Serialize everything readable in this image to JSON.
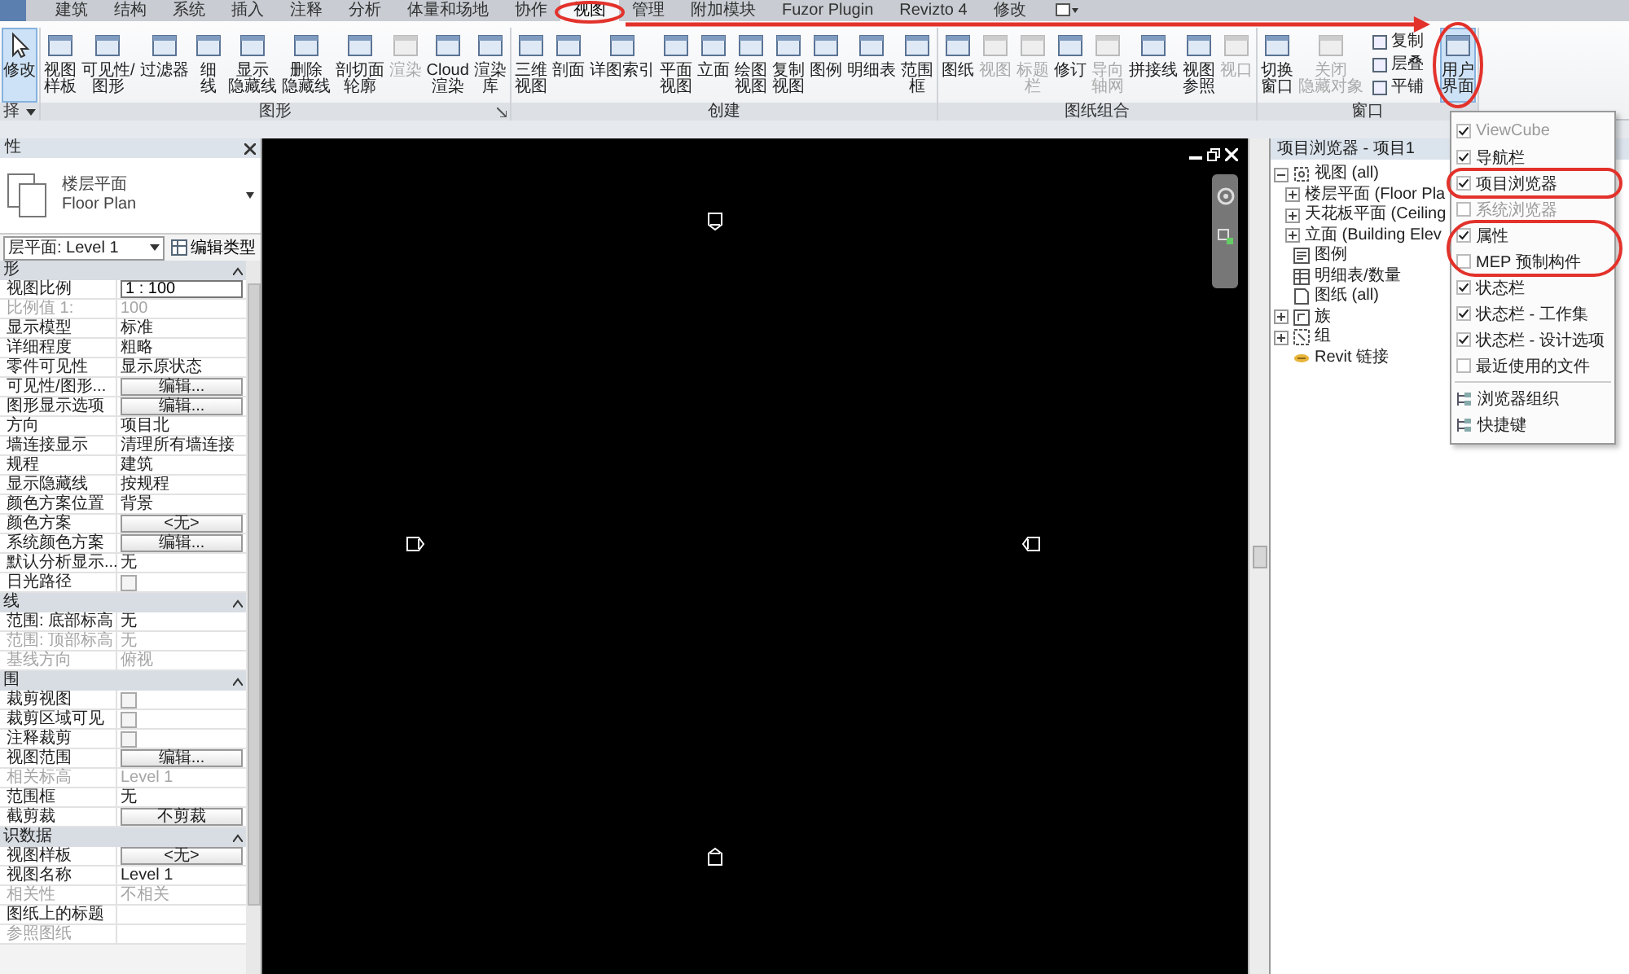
{
  "ribbon_tabs": [
    {
      "label": "建筑",
      "selected": false
    },
    {
      "label": "结构",
      "selected": false
    },
    {
      "label": "系统",
      "selected": false
    },
    {
      "label": "插入",
      "selected": false
    },
    {
      "label": "注释",
      "selected": false
    },
    {
      "label": "分析",
      "selected": false
    },
    {
      "label": "体量和场地",
      "selected": false
    },
    {
      "label": "协作",
      "selected": false
    },
    {
      "label": "视图",
      "selected": true
    },
    {
      "label": "管理",
      "selected": false
    },
    {
      "label": "附加模块",
      "selected": false
    },
    {
      "label": "Fuzor Plugin",
      "selected": false
    },
    {
      "label": "Revizto 4",
      "selected": false
    },
    {
      "label": "修改",
      "selected": false
    }
  ],
  "ribbon_groups": [
    {
      "label": "择",
      "dropdown": true,
      "buttons": [
        {
          "kind": "large",
          "lines": [
            "修改"
          ],
          "active": true,
          "disabled": false
        }
      ]
    },
    {
      "label": "图形",
      "launcher": true,
      "buttons": [
        {
          "kind": "large",
          "lines": [
            "视图",
            "样板"
          ],
          "active": false,
          "disabled": false
        },
        {
          "kind": "large",
          "lines": [
            "可见性/",
            "图形"
          ],
          "active": false,
          "disabled": false
        },
        {
          "kind": "large",
          "lines": [
            "过滤器"
          ],
          "active": false,
          "disabled": false
        },
        {
          "kind": "large",
          "lines": [
            "细",
            "线"
          ],
          "active": false,
          "disabled": false
        },
        {
          "kind": "large",
          "lines": [
            "显示",
            "隐藏线"
          ],
          "active": false,
          "disabled": false
        },
        {
          "kind": "large",
          "lines": [
            "删除",
            "隐藏线"
          ],
          "active": false,
          "disabled": false
        },
        {
          "kind": "large",
          "lines": [
            "剖切面",
            "轮廓"
          ],
          "active": false,
          "disabled": false
        },
        {
          "kind": "large",
          "lines": [
            "渲染"
          ],
          "active": false,
          "disabled": true
        },
        {
          "kind": "large",
          "lines": [
            "Cloud",
            "渲染"
          ],
          "active": false,
          "disabled": false
        },
        {
          "kind": "large",
          "lines": [
            "渲染",
            "库"
          ],
          "active": false,
          "disabled": false
        }
      ]
    },
    {
      "label": "创建",
      "buttons": [
        {
          "kind": "large",
          "lines": [
            "三维",
            "视图"
          ],
          "active": false,
          "disabled": false
        },
        {
          "kind": "large",
          "lines": [
            "剖面"
          ],
          "active": false,
          "disabled": false
        },
        {
          "kind": "large",
          "lines": [
            "详图索引"
          ],
          "active": false,
          "disabled": false
        },
        {
          "kind": "large",
          "lines": [
            "平面",
            "视图"
          ],
          "active": false,
          "disabled": false
        },
        {
          "kind": "large",
          "lines": [
            "立面"
          ],
          "active": false,
          "disabled": false
        },
        {
          "kind": "large",
          "lines": [
            "绘图",
            "视图"
          ],
          "active": false,
          "disabled": false
        },
        {
          "kind": "large",
          "lines": [
            "复制",
            "视图"
          ],
          "active": false,
          "disabled": false
        },
        {
          "kind": "large",
          "lines": [
            "图例"
          ],
          "active": false,
          "disabled": false
        },
        {
          "kind": "large",
          "lines": [
            "明细表"
          ],
          "active": false,
          "disabled": false
        },
        {
          "kind": "large",
          "lines": [
            "范围",
            "框"
          ],
          "active": false,
          "disabled": false
        }
      ]
    },
    {
      "label": "图纸组合",
      "buttons": [
        {
          "kind": "large",
          "lines": [
            "图纸"
          ],
          "active": false,
          "disabled": false
        },
        {
          "kind": "large",
          "lines": [
            "视图"
          ],
          "active": false,
          "disabled": true
        },
        {
          "kind": "large",
          "lines": [
            "标题",
            "栏"
          ],
          "active": false,
          "disabled": true
        },
        {
          "kind": "large",
          "lines": [
            "修订"
          ],
          "active": false,
          "disabled": false
        },
        {
          "kind": "large",
          "lines": [
            "导向",
            "轴网"
          ],
          "active": false,
          "disabled": true
        },
        {
          "kind": "large",
          "lines": [
            "拼接线"
          ],
          "active": false,
          "disabled": false
        },
        {
          "kind": "large",
          "lines": [
            "视图",
            "参照"
          ],
          "active": false,
          "disabled": false
        },
        {
          "kind": "large",
          "lines": [
            "视口"
          ],
          "active": false,
          "disabled": true
        }
      ]
    },
    {
      "label": "窗口",
      "buttons": [
        {
          "kind": "large",
          "lines": [
            "切换",
            "窗口"
          ],
          "active": false,
          "disabled": false
        },
        {
          "kind": "large",
          "lines": [
            "关闭",
            "隐藏对象"
          ],
          "active": false,
          "disabled": true
        },
        {
          "kind": "stack",
          "items": [
            {
              "label": "复制",
              "disabled": false
            },
            {
              "label": "层叠",
              "disabled": false
            },
            {
              "label": "平铺",
              "disabled": false
            }
          ]
        },
        {
          "kind": "large",
          "lines": [
            "用户",
            "界面"
          ],
          "active": true,
          "disabled": false
        }
      ]
    }
  ],
  "properties": {
    "title": "性",
    "type_name": "楼层平面",
    "type_name_en": "Floor Plan",
    "instance_dropdown": "层平面: Level 1",
    "edit_type_button": "编辑类型",
    "sections": [
      {
        "title": "形",
        "expanded": true,
        "rows": [
          {
            "label": "视图比例",
            "kind": "input",
            "value": "1 : 100",
            "disabled": false
          },
          {
            "label": "比例值 1:",
            "kind": "text",
            "value": "100",
            "disabled": true
          },
          {
            "label": "显示模型",
            "kind": "text",
            "value": "标准",
            "disabled": false
          },
          {
            "label": "详细程度",
            "kind": "text",
            "value": "粗略",
            "disabled": false
          },
          {
            "label": "零件可见性",
            "kind": "text",
            "value": "显示原状态",
            "disabled": false
          },
          {
            "label": "可见性/图形...",
            "kind": "button",
            "value": "编辑...",
            "disabled": false
          },
          {
            "label": "图形显示选项",
            "kind": "button",
            "value": "编辑...",
            "disabled": false
          },
          {
            "label": "方向",
            "kind": "text",
            "value": "项目北",
            "disabled": false
          },
          {
            "label": "墙连接显示",
            "kind": "text",
            "value": "清理所有墙连接",
            "disabled": false
          },
          {
            "label": "规程",
            "kind": "text",
            "value": "建筑",
            "disabled": false
          },
          {
            "label": "显示隐藏线",
            "kind": "text",
            "value": "按规程",
            "disabled": false
          },
          {
            "label": "颜色方案位置",
            "kind": "text",
            "value": "背景",
            "disabled": false
          },
          {
            "label": "颜色方案",
            "kind": "button",
            "value": "<无>",
            "disabled": false
          },
          {
            "label": "系统颜色方案",
            "kind": "button",
            "value": "编辑...",
            "disabled": false
          },
          {
            "label": "默认分析显示...",
            "kind": "text",
            "value": "无",
            "disabled": false
          },
          {
            "label": "日光路径",
            "kind": "checkbox",
            "checked": false,
            "disabled": false
          }
        ]
      },
      {
        "title": "线",
        "expanded": true,
        "rows": [
          {
            "label": "范围: 底部标高",
            "kind": "text",
            "value": "无",
            "disabled": false
          },
          {
            "label": "范围: 顶部标高",
            "kind": "text",
            "value": "无",
            "disabled": true
          },
          {
            "label": "基线方向",
            "kind": "text",
            "value": "俯视",
            "disabled": true
          }
        ]
      },
      {
        "title": "围",
        "expanded": true,
        "rows": [
          {
            "label": "裁剪视图",
            "kind": "checkbox",
            "checked": false,
            "disabled": false
          },
          {
            "label": "裁剪区域可见",
            "kind": "checkbox",
            "checked": false,
            "disabled": false
          },
          {
            "label": "注释裁剪",
            "kind": "checkbox",
            "checked": false,
            "disabled": false
          },
          {
            "label": "视图范围",
            "kind": "button",
            "value": "编辑...",
            "disabled": false
          },
          {
            "label": "相关标高",
            "kind": "text",
            "value": "Level 1",
            "disabled": true
          },
          {
            "label": "范围框",
            "kind": "text",
            "value": "无",
            "disabled": false
          },
          {
            "label": "截剪裁",
            "kind": "button",
            "value": "不剪裁",
            "disabled": false
          }
        ]
      },
      {
        "title": "识数据",
        "expanded": true,
        "rows": [
          {
            "label": "视图样板",
            "kind": "button",
            "value": "<无>",
            "disabled": false
          },
          {
            "label": "视图名称",
            "kind": "text",
            "value": "Level 1",
            "disabled": false
          },
          {
            "label": "相关性",
            "kind": "text",
            "value": "不相关",
            "disabled": true
          },
          {
            "label": "图纸上的标题",
            "kind": "text",
            "disabled": false
          },
          {
            "label": "参照图纸",
            "kind": "text",
            "disabled": true
          }
        ]
      }
    ]
  },
  "project_browser": {
    "title": "项目浏览器 - 项目1",
    "tree": [
      {
        "label": "视图 (all)",
        "kind": "views",
        "expanded": true,
        "children": [
          {
            "label": "楼层平面 (Floor Pla",
            "expanded": false
          },
          {
            "label": "天花板平面 (Ceiling",
            "expanded": false
          },
          {
            "label": "立面 (Building Elev",
            "expanded": false
          }
        ]
      },
      {
        "label": "图例",
        "kind": "legend"
      },
      {
        "label": "明细表/数量",
        "kind": "schedule"
      },
      {
        "label": "图纸 (all)",
        "kind": "sheet"
      },
      {
        "label": "族",
        "kind": "family",
        "expanded": false
      },
      {
        "label": "组",
        "kind": "group",
        "expanded": false
      },
      {
        "label": "Revit 链接",
        "kind": "link"
      }
    ]
  },
  "user_interface_menu": [
    {
      "kind": "check",
      "label": "ViewCube",
      "checked": true,
      "disabled": true
    },
    {
      "kind": "check",
      "label": "导航栏",
      "checked": true,
      "disabled": false
    },
    {
      "kind": "check",
      "label": "项目浏览器",
      "checked": true,
      "disabled": false
    },
    {
      "kind": "check",
      "label": "系统浏览器",
      "checked": false,
      "disabled": true
    },
    {
      "kind": "check",
      "label": "属性",
      "checked": true,
      "disabled": false
    },
    {
      "kind": "check",
      "label": "MEP 预制构件",
      "checked": false,
      "disabled": false
    },
    {
      "kind": "check",
      "label": "状态栏",
      "checked": true,
      "disabled": false
    },
    {
      "kind": "check",
      "label": "状态栏 - 工作集",
      "checked": true,
      "disabled": false
    },
    {
      "kind": "check",
      "label": "状态栏 - 设计选项",
      "checked": true,
      "disabled": false
    },
    {
      "kind": "check",
      "label": "最近使用的文件",
      "checked": false,
      "disabled": false
    },
    {
      "kind": "separator"
    },
    {
      "kind": "action",
      "label": "浏览器组织"
    },
    {
      "kind": "action",
      "label": "快捷键"
    }
  ]
}
